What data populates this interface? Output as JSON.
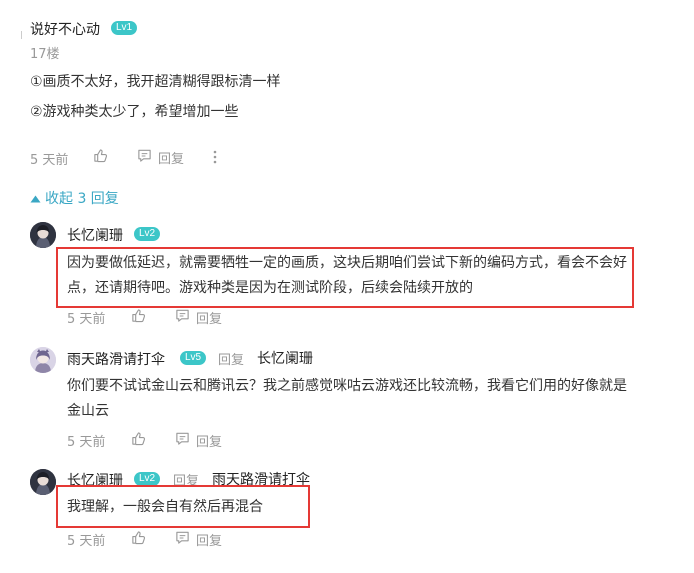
{
  "main_comment": {
    "username": "说好不心动",
    "level": "Lv1",
    "floor": "17楼",
    "lines": [
      "①画质不太好，我开超清糊得跟标清一样",
      "②游戏种类太少了，希望增加一些"
    ],
    "time": "5 天前",
    "reply_label": "回复",
    "more_icon": "more-vertical-icon"
  },
  "collapse": {
    "label": "收起 3 回复"
  },
  "replies": [
    {
      "username": "长忆阑珊",
      "level": "Lv2",
      "text": "因为要做低延迟，就需要牺牲一定的画质，这块后期咱们尝试下新的编码方式，看会不会好点，还请期待吧。游戏种类是因为在测试阶段，后续会陆续开放的",
      "time": "5 天前",
      "reply_label": "回复"
    },
    {
      "username": "雨天路滑请打伞",
      "level": "Lv5",
      "reply_word": "回复",
      "reply_target": "长忆阑珊",
      "text": "你们要不试试金山云和腾讯云？我之前感觉咪咕云游戏还比较流畅，我看它们用的好像就是金山云",
      "time": "5 天前",
      "reply_label": "回复"
    },
    {
      "username": "长忆阑珊",
      "level": "Lv2",
      "reply_word": "回复",
      "reply_target": "雨天路滑请打伞",
      "text": "我理解，一般会自有然后再混合",
      "time": "5 天前",
      "reply_label": "回复"
    }
  ],
  "colors": {
    "accent": "#3aa7c4",
    "level_badge": "#3cc6c8",
    "highlight_box": "#e53935"
  }
}
